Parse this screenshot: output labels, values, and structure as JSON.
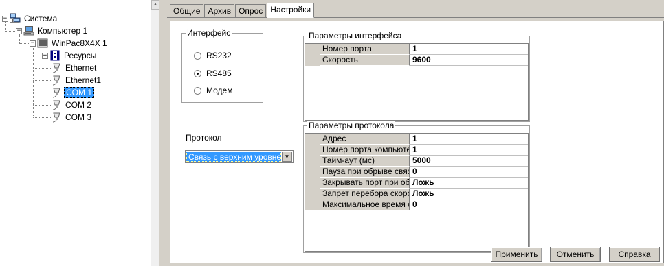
{
  "tree": {
    "root": "Система",
    "computer": "Компьютер 1",
    "controller": "WinPac8X4X 1",
    "resources": "Ресурсы",
    "ethernet": "Ethernet",
    "ethernet1": "Ethernet1",
    "com1": "COM 1",
    "com2": "COM 2",
    "com3": "COM 3"
  },
  "tabs": [
    "Общие",
    "Архив",
    "Опрос",
    "Настройки"
  ],
  "interface_group": {
    "title": "Интерфейс",
    "options": [
      "RS232",
      "RS485",
      "Модем"
    ],
    "selected": "RS485"
  },
  "protocol": {
    "label": "Протокол",
    "selected": "Связь с верхним уровнем"
  },
  "interface_params": {
    "title": "Параметры интерфейса",
    "rows": [
      {
        "name": "Номер порта",
        "value": "1"
      },
      {
        "name": "Скорость",
        "value": "9600"
      }
    ]
  },
  "protocol_params": {
    "title": "Параметры протокола",
    "rows": [
      {
        "name": "Адрес",
        "value": "1"
      },
      {
        "name": "Номер порта компьютер",
        "value": "1"
      },
      {
        "name": "Тайм-аут (мс)",
        "value": "5000"
      },
      {
        "name": "Пауза при обрыве связи",
        "value": "0"
      },
      {
        "name": "Закрывать порт при обр",
        "value": "Ложь"
      },
      {
        "name": "Запрет перебора скорос",
        "value": "Ложь"
      },
      {
        "name": "Максимальное время се",
        "value": "0"
      }
    ]
  },
  "buttons": {
    "apply": "Применить",
    "cancel": "Отменить",
    "help": "Справка"
  },
  "icons": {
    "system": "network-computers-icon",
    "computer": "computer-icon",
    "controller": "controller-icon",
    "resources": "resources-icon",
    "port": "port-plug-icon"
  }
}
